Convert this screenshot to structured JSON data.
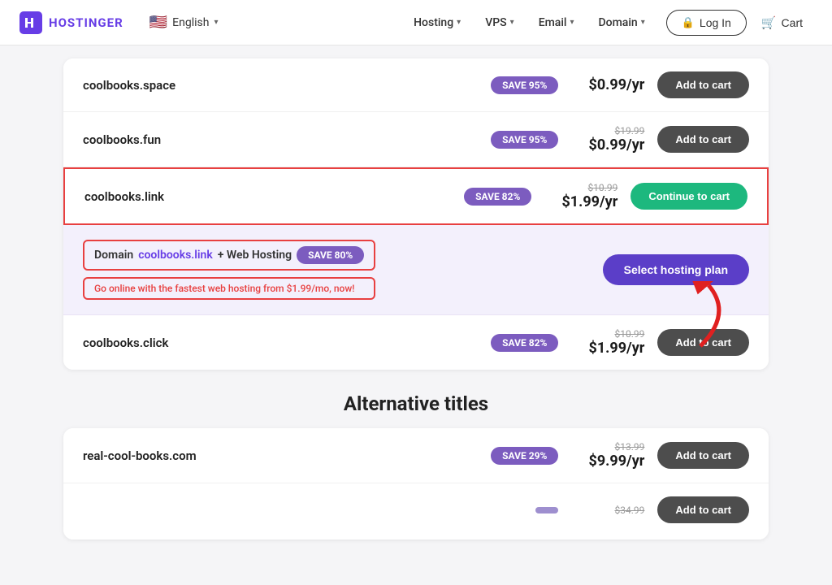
{
  "navbar": {
    "logo_text": "HOSTINGER",
    "lang_label": "English",
    "nav_items": [
      {
        "label": "Hosting",
        "id": "hosting"
      },
      {
        "label": "VPS",
        "id": "vps"
      },
      {
        "label": "Email",
        "id": "email"
      },
      {
        "label": "Domain",
        "id": "domain"
      }
    ],
    "login_label": "Log In",
    "cart_label": "Cart"
  },
  "domains": [
    {
      "name": "coolbooks.space",
      "save_badge": "SAVE 95%",
      "price_original": "",
      "price_main": "$0.99/yr",
      "btn_label": "Add to cart",
      "btn_type": "add",
      "highlighted": false,
      "bundle": false
    },
    {
      "name": "coolbooks.fun",
      "save_badge": "SAVE 95%",
      "price_original": "$19.99",
      "price_main": "$0.99/yr",
      "btn_label": "Add to cart",
      "btn_type": "add",
      "highlighted": false,
      "bundle": false
    },
    {
      "name": "coolbooks.link",
      "save_badge": "SAVE 82%",
      "price_original": "$10.99",
      "price_main": "$1.99/yr",
      "btn_label": "Continue to cart",
      "btn_type": "continue",
      "highlighted": true,
      "bundle": false
    },
    {
      "bundle": true,
      "bundle_prefix": "Domain ",
      "bundle_link": "coolbooks.link",
      "bundle_suffix": " + Web Hosting",
      "bundle_save": "SAVE 80%",
      "bundle_subtitle": "Go online with the fastest web hosting from $1.99/mo, now!",
      "btn_label": "Select hosting plan",
      "btn_type": "select"
    },
    {
      "name": "coolbooks.click",
      "save_badge": "SAVE 82%",
      "price_original": "$10.99",
      "price_main": "$1.99/yr",
      "btn_label": "Add to cart",
      "btn_type": "add",
      "highlighted": false,
      "bundle": false
    }
  ],
  "alt_section_title": "Alternative titles",
  "alt_domains": [
    {
      "name": "real-cool-books.com",
      "save_badge": "SAVE 29%",
      "price_original": "$13.99",
      "price_main": "$9.99/yr",
      "btn_label": "Add to cart",
      "btn_type": "add"
    },
    {
      "name": "",
      "save_badge": "",
      "price_original": "$34.99",
      "price_main": "",
      "btn_label": "Add to cart",
      "btn_type": "add"
    }
  ]
}
